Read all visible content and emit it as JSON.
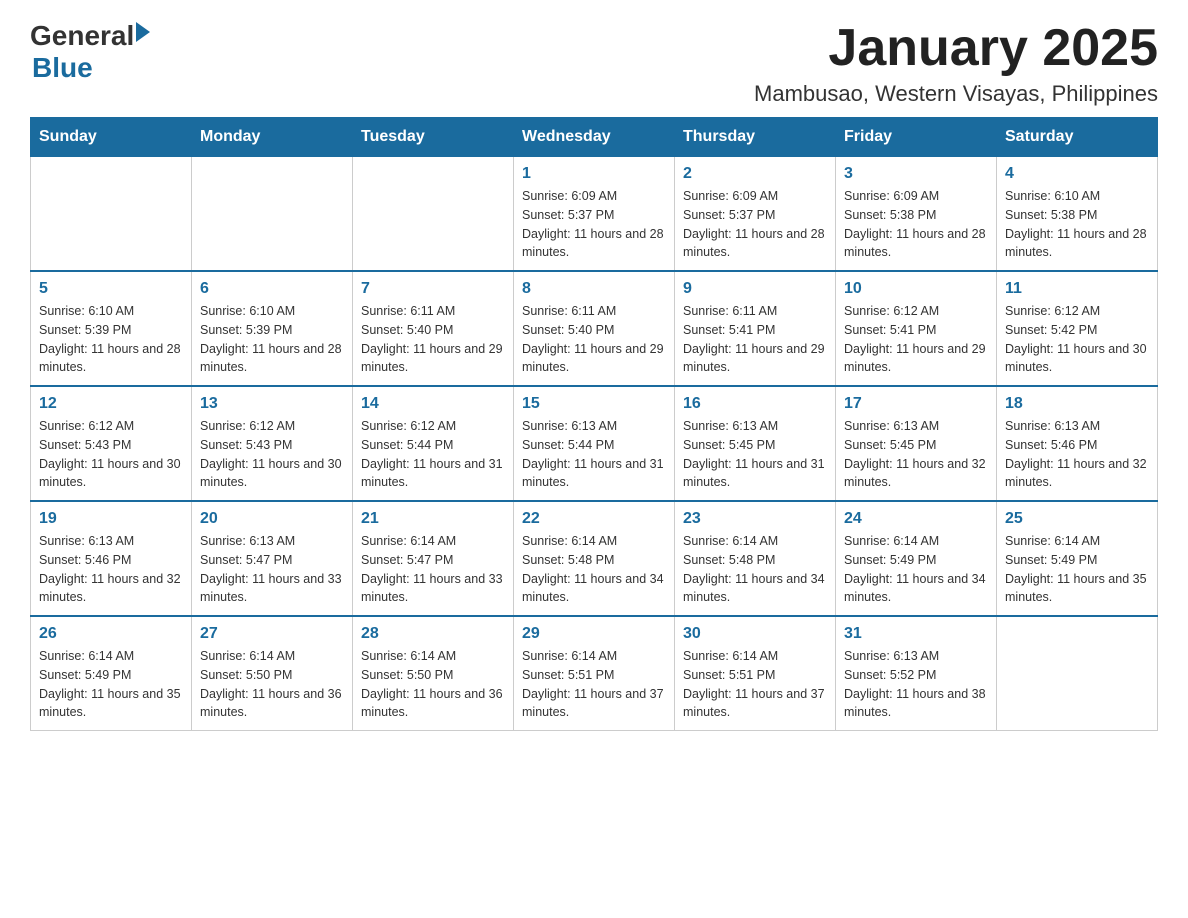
{
  "header": {
    "logo_general": "General",
    "logo_blue": "Blue",
    "month_title": "January 2025",
    "location": "Mambusao, Western Visayas, Philippines"
  },
  "days_of_week": [
    "Sunday",
    "Monday",
    "Tuesday",
    "Wednesday",
    "Thursday",
    "Friday",
    "Saturday"
  ],
  "weeks": [
    [
      {
        "day": "",
        "info": ""
      },
      {
        "day": "",
        "info": ""
      },
      {
        "day": "",
        "info": ""
      },
      {
        "day": "1",
        "info": "Sunrise: 6:09 AM\nSunset: 5:37 PM\nDaylight: 11 hours and 28 minutes."
      },
      {
        "day": "2",
        "info": "Sunrise: 6:09 AM\nSunset: 5:37 PM\nDaylight: 11 hours and 28 minutes."
      },
      {
        "day": "3",
        "info": "Sunrise: 6:09 AM\nSunset: 5:38 PM\nDaylight: 11 hours and 28 minutes."
      },
      {
        "day": "4",
        "info": "Sunrise: 6:10 AM\nSunset: 5:38 PM\nDaylight: 11 hours and 28 minutes."
      }
    ],
    [
      {
        "day": "5",
        "info": "Sunrise: 6:10 AM\nSunset: 5:39 PM\nDaylight: 11 hours and 28 minutes."
      },
      {
        "day": "6",
        "info": "Sunrise: 6:10 AM\nSunset: 5:39 PM\nDaylight: 11 hours and 28 minutes."
      },
      {
        "day": "7",
        "info": "Sunrise: 6:11 AM\nSunset: 5:40 PM\nDaylight: 11 hours and 29 minutes."
      },
      {
        "day": "8",
        "info": "Sunrise: 6:11 AM\nSunset: 5:40 PM\nDaylight: 11 hours and 29 minutes."
      },
      {
        "day": "9",
        "info": "Sunrise: 6:11 AM\nSunset: 5:41 PM\nDaylight: 11 hours and 29 minutes."
      },
      {
        "day": "10",
        "info": "Sunrise: 6:12 AM\nSunset: 5:41 PM\nDaylight: 11 hours and 29 minutes."
      },
      {
        "day": "11",
        "info": "Sunrise: 6:12 AM\nSunset: 5:42 PM\nDaylight: 11 hours and 30 minutes."
      }
    ],
    [
      {
        "day": "12",
        "info": "Sunrise: 6:12 AM\nSunset: 5:43 PM\nDaylight: 11 hours and 30 minutes."
      },
      {
        "day": "13",
        "info": "Sunrise: 6:12 AM\nSunset: 5:43 PM\nDaylight: 11 hours and 30 minutes."
      },
      {
        "day": "14",
        "info": "Sunrise: 6:12 AM\nSunset: 5:44 PM\nDaylight: 11 hours and 31 minutes."
      },
      {
        "day": "15",
        "info": "Sunrise: 6:13 AM\nSunset: 5:44 PM\nDaylight: 11 hours and 31 minutes."
      },
      {
        "day": "16",
        "info": "Sunrise: 6:13 AM\nSunset: 5:45 PM\nDaylight: 11 hours and 31 minutes."
      },
      {
        "day": "17",
        "info": "Sunrise: 6:13 AM\nSunset: 5:45 PM\nDaylight: 11 hours and 32 minutes."
      },
      {
        "day": "18",
        "info": "Sunrise: 6:13 AM\nSunset: 5:46 PM\nDaylight: 11 hours and 32 minutes."
      }
    ],
    [
      {
        "day": "19",
        "info": "Sunrise: 6:13 AM\nSunset: 5:46 PM\nDaylight: 11 hours and 32 minutes."
      },
      {
        "day": "20",
        "info": "Sunrise: 6:13 AM\nSunset: 5:47 PM\nDaylight: 11 hours and 33 minutes."
      },
      {
        "day": "21",
        "info": "Sunrise: 6:14 AM\nSunset: 5:47 PM\nDaylight: 11 hours and 33 minutes."
      },
      {
        "day": "22",
        "info": "Sunrise: 6:14 AM\nSunset: 5:48 PM\nDaylight: 11 hours and 34 minutes."
      },
      {
        "day": "23",
        "info": "Sunrise: 6:14 AM\nSunset: 5:48 PM\nDaylight: 11 hours and 34 minutes."
      },
      {
        "day": "24",
        "info": "Sunrise: 6:14 AM\nSunset: 5:49 PM\nDaylight: 11 hours and 34 minutes."
      },
      {
        "day": "25",
        "info": "Sunrise: 6:14 AM\nSunset: 5:49 PM\nDaylight: 11 hours and 35 minutes."
      }
    ],
    [
      {
        "day": "26",
        "info": "Sunrise: 6:14 AM\nSunset: 5:49 PM\nDaylight: 11 hours and 35 minutes."
      },
      {
        "day": "27",
        "info": "Sunrise: 6:14 AM\nSunset: 5:50 PM\nDaylight: 11 hours and 36 minutes."
      },
      {
        "day": "28",
        "info": "Sunrise: 6:14 AM\nSunset: 5:50 PM\nDaylight: 11 hours and 36 minutes."
      },
      {
        "day": "29",
        "info": "Sunrise: 6:14 AM\nSunset: 5:51 PM\nDaylight: 11 hours and 37 minutes."
      },
      {
        "day": "30",
        "info": "Sunrise: 6:14 AM\nSunset: 5:51 PM\nDaylight: 11 hours and 37 minutes."
      },
      {
        "day": "31",
        "info": "Sunrise: 6:13 AM\nSunset: 5:52 PM\nDaylight: 11 hours and 38 minutes."
      },
      {
        "day": "",
        "info": ""
      }
    ]
  ]
}
